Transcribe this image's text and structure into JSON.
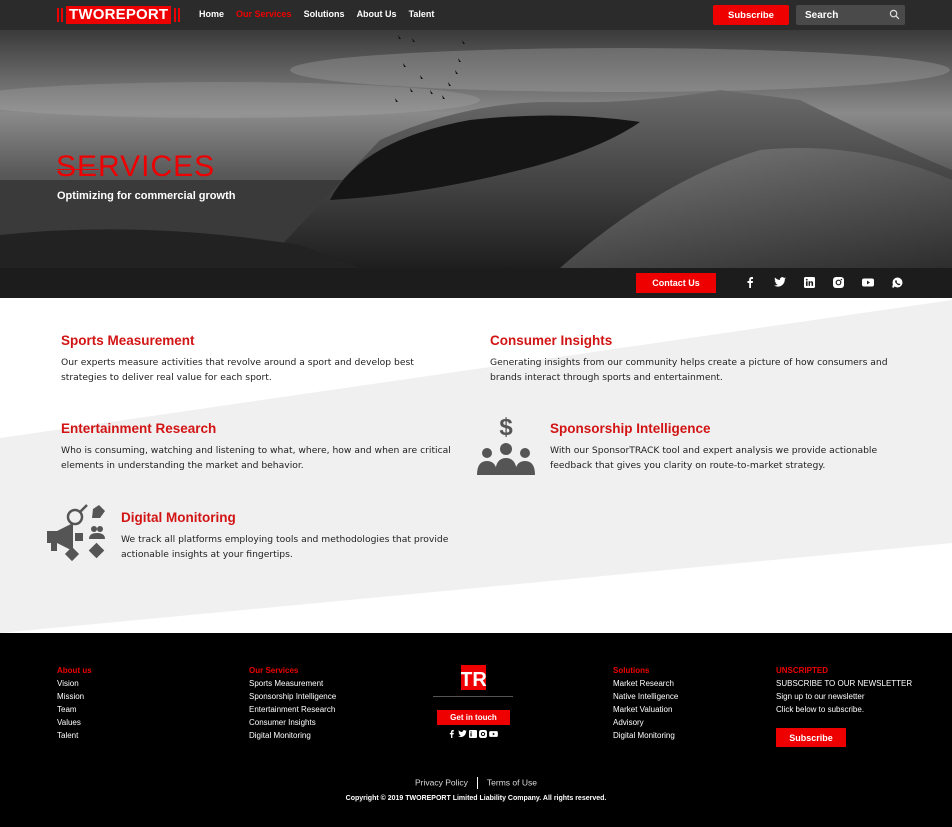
{
  "nav": {
    "logo_text": "TWOREPORT",
    "links": [
      {
        "label": "Home",
        "active": false
      },
      {
        "label": "Our Services",
        "active": true
      },
      {
        "label": "Solutions",
        "active": false
      },
      {
        "label": "About Us",
        "active": false
      },
      {
        "label": "Talent",
        "active": false
      }
    ],
    "subscribe_label": "Subscribe",
    "search_placeholder": "Search"
  },
  "hero": {
    "title": "SERVICES",
    "subtitle": "Optimizing for commercial growth"
  },
  "bar": {
    "contact_label": "Contact Us",
    "socials": [
      "facebook-icon",
      "twitter-icon",
      "linkedin-icon",
      "instagram-icon",
      "youtube-icon",
      "whatsapp-icon"
    ]
  },
  "services": {
    "sports": {
      "title": "Sports Measurement",
      "text": "Our experts measure activities that revolve around a sport and develop best strategies to deliver real value for each sport."
    },
    "consumer": {
      "title": "Consumer Insights",
      "text": "Generating insights from our community helps create a picture of how consumers and brands interact through sports and entertainment."
    },
    "entertainment": {
      "title": "Entertainment Research",
      "text": "Who is consuming, watching and listening to what, where, how and when are critical elements in understanding the market and behavior."
    },
    "sponsorship": {
      "title": "Sponsorship Intelligence",
      "text": "With our SponsorTRACK tool and expert analysis we provide actionable feedback that gives you clarity on route-to-market strategy."
    },
    "digital": {
      "title": "Digital Monitoring",
      "text": "We track all platforms employing tools and methodologies that provide actionable insights at your fingertips."
    }
  },
  "footer": {
    "about": {
      "heading": "About us",
      "items": [
        "Vision",
        "Mission",
        "Team",
        "Values",
        "Talent"
      ]
    },
    "services": {
      "heading": "Our Services",
      "items": [
        "Sports Measurement",
        "Sponsorship Intelligence",
        "Entertainment Research",
        "Consumer Insights",
        "Digital Monitoring"
      ]
    },
    "logo_text": "TR",
    "get_in_touch": "Get in touch",
    "solutions": {
      "heading": "Solutions",
      "items": [
        "Market Research",
        "Native Intelligence",
        "Market Valuation",
        "Advisory",
        "Digital Monitoring"
      ]
    },
    "newsletter": {
      "heading": "UNSCRIPTED",
      "line1": "SUBSCRIBE TO OUR NEWSLETTER",
      "line2": "Sign up to our newsletter",
      "line3": "Click below to subscribe.",
      "button": "Subscribe"
    },
    "privacy": "Privacy Policy",
    "terms": "Terms of Use",
    "copyright": "Copyright © 2019 TWOREPORT Limited Liability Company. All rights reserved."
  },
  "colors": {
    "accent": "#e00000",
    "nav_bg": "#2b2b2b",
    "footer_bg": "#000000"
  }
}
